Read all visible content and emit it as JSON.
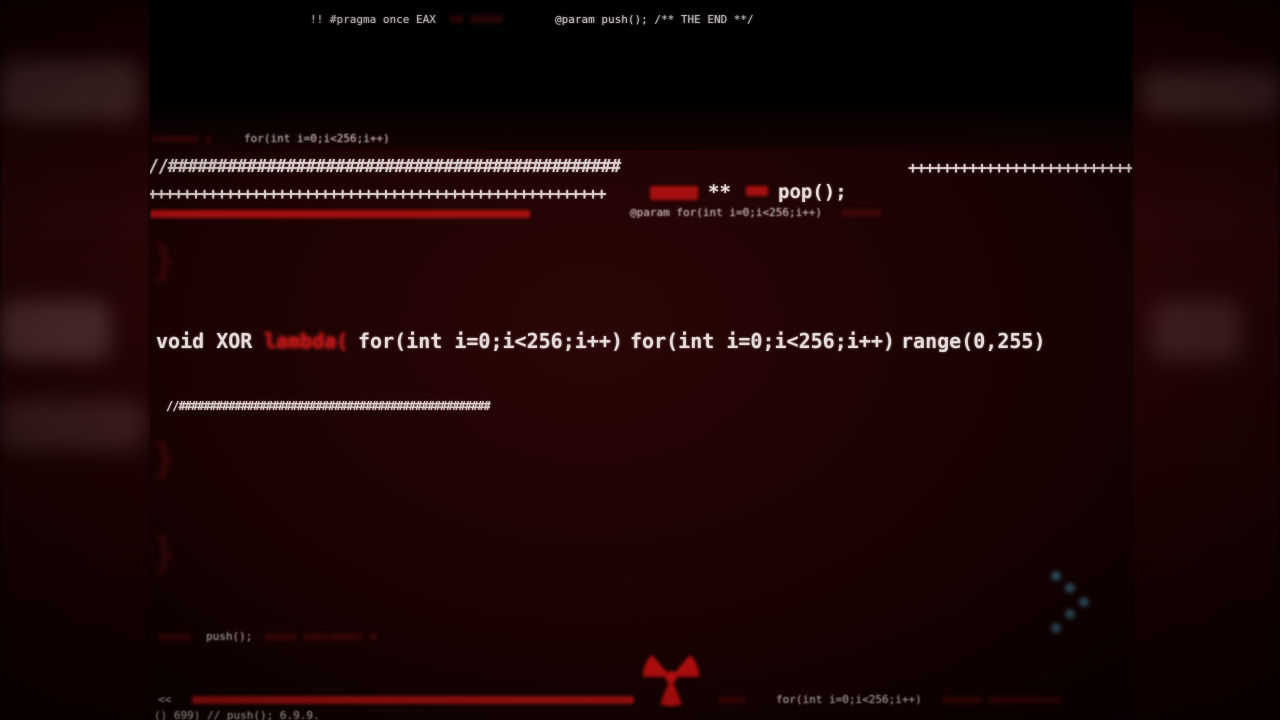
{
  "colors": {
    "text": "#e4dcdc",
    "accent_red": "#c71818",
    "background": "#1d0303"
  },
  "code": {
    "top_line": "!! #pragma once EAX",
    "top_param": "@param push(); /** THE END **/",
    "line_for_small": "for(int i=0;i<256;i++)",
    "hash_line": "//##############################################",
    "plus_line_right": "+++++++++++++++++++++++++++",
    "plus_line_left": "+++++++++++++++++++++++++++++++++++++++++++++++++++++",
    "double_star": "**",
    "pop_call": "pop();",
    "param_for": "@param for(int i=0;i<256;i++)",
    "main_void": "void XOR",
    "main_lambda": "lambda(",
    "main_for_1": "for(int i=0;i<256;i++)",
    "main_for_2": "for(int i=0;i<256;i++)",
    "main_range": "range(0,255)",
    "comment_hash": "//##################################################",
    "push_call": "push();",
    "bottom_chevron": "<<",
    "bottom_for": "for(int i=0;i<256;i++)",
    "bottom_last": "() 699) // push(); 6.9.9."
  },
  "icons": {
    "hazard": "radiation-hazard-icon",
    "dots": "dot-cluster-icon"
  }
}
